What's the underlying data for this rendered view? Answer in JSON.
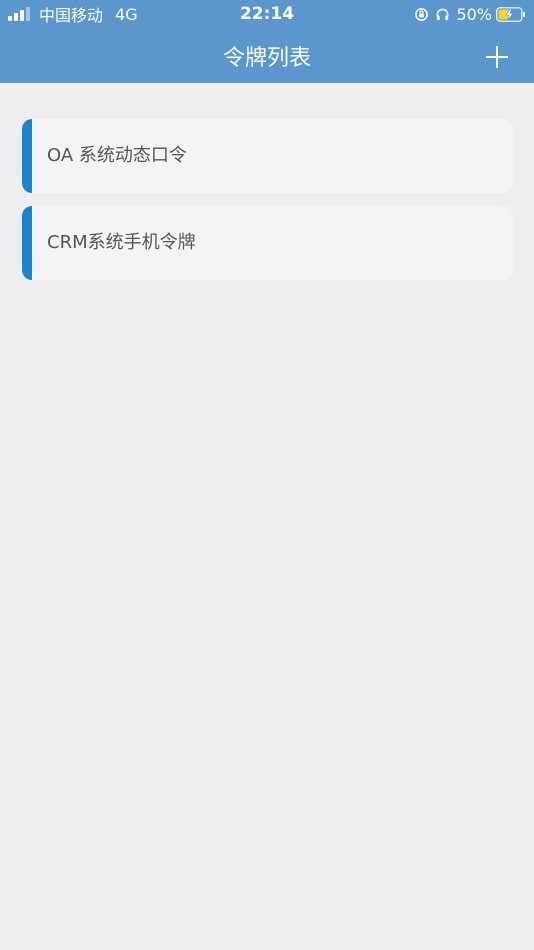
{
  "status_bar": {
    "carrier": "中国移动",
    "network": "4G",
    "time": "22:14",
    "battery_percent": "50%",
    "icons": [
      "signal-icon",
      "orientation-lock-icon",
      "headphones-icon",
      "battery-charging-icon"
    ]
  },
  "header": {
    "title": "令牌列表",
    "add_icon": "plus-icon"
  },
  "tokens": [
    {
      "label": "OA 系统动态口令"
    },
    {
      "label": "CRM系统手机令牌"
    }
  ],
  "colors": {
    "header_bg": "#5b97cd",
    "page_bg": "#eeeef0",
    "card_bg": "#f4f3f6",
    "accent": "#1b84c8",
    "label_text": "#555555"
  }
}
